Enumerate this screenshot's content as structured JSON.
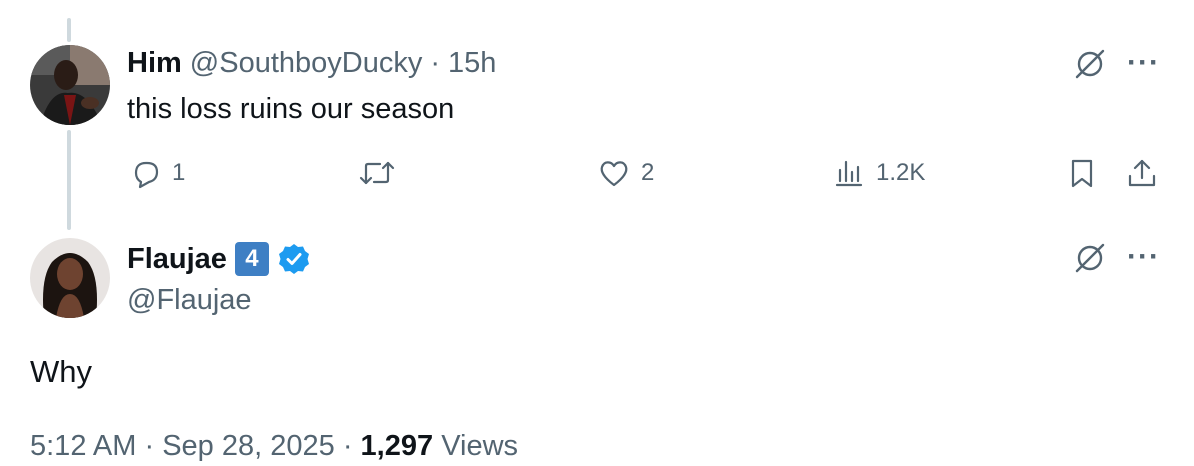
{
  "reply_tweet": {
    "display_name": "Him",
    "handle": "@SouthboyDucky",
    "separator": "·",
    "time": "15h",
    "text": "this loss ruins our season",
    "actions": {
      "replies": "1",
      "retweets": "",
      "likes": "2",
      "views": "1.2K"
    },
    "icons": [
      "avatar-photo",
      "grok-icon",
      "more-icon",
      "reply-icon",
      "retweet-icon",
      "like-icon",
      "views-icon",
      "bookmark-icon",
      "share-icon"
    ]
  },
  "main_tweet": {
    "display_name": "Flaujae",
    "badge_number": "4",
    "verified": true,
    "handle": "@Flaujae",
    "text": "Why",
    "footer": {
      "time": "5:12 AM",
      "sep1": "·",
      "date": "Sep 28, 2025",
      "sep2": "·",
      "views_count": "1,297",
      "views_label": "Views"
    },
    "icons": [
      "avatar-photo",
      "verified-badge-icon",
      "grok-icon",
      "more-icon"
    ]
  },
  "colors": {
    "text_primary": "#0f1419",
    "text_secondary": "#536471",
    "thread_line": "#cfd9de",
    "verified_blue": "#1d9bf0",
    "badge_blue": "#3e7fc4"
  }
}
